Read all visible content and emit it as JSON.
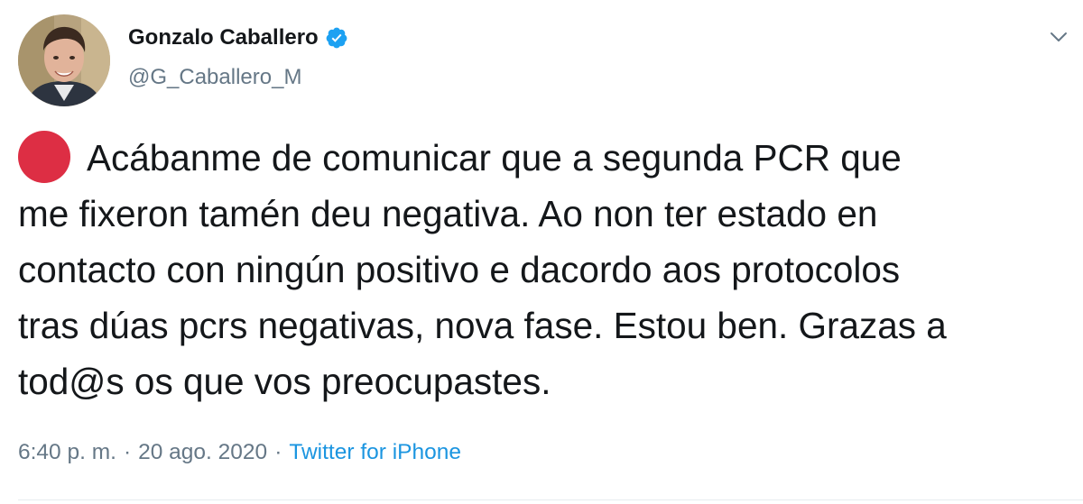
{
  "author": {
    "display_name": "Gonzalo Caballero",
    "handle": "@G_Caballero_M",
    "verified": true,
    "avatar_icon": "profile-photo"
  },
  "tweet": {
    "emoji_icon": "red-circle-emoji",
    "lines": [
      "Acábanme de comunicar que a segunda PCR que",
      "me fixeron tamén deu negativa. Ao non ter estado en",
      "contacto con ningún positivo e dacordo aos protocolos",
      "tras dúas pcrs negativas, nova fase. Estou ben. Grazas a",
      "tod@s os que vos preocupastes."
    ]
  },
  "meta": {
    "time": "6:40 p. m.",
    "separator": "·",
    "date": "20 ago. 2020",
    "source": "Twitter for iPhone"
  },
  "colors": {
    "text": "#14171a",
    "secondary": "#657786",
    "link": "#1b95e0",
    "verified": "#1da1f2",
    "emoji_red": "#dd2e44"
  },
  "icons": {
    "verified": "verified-badge-icon",
    "menu": "chevron-down-icon"
  }
}
